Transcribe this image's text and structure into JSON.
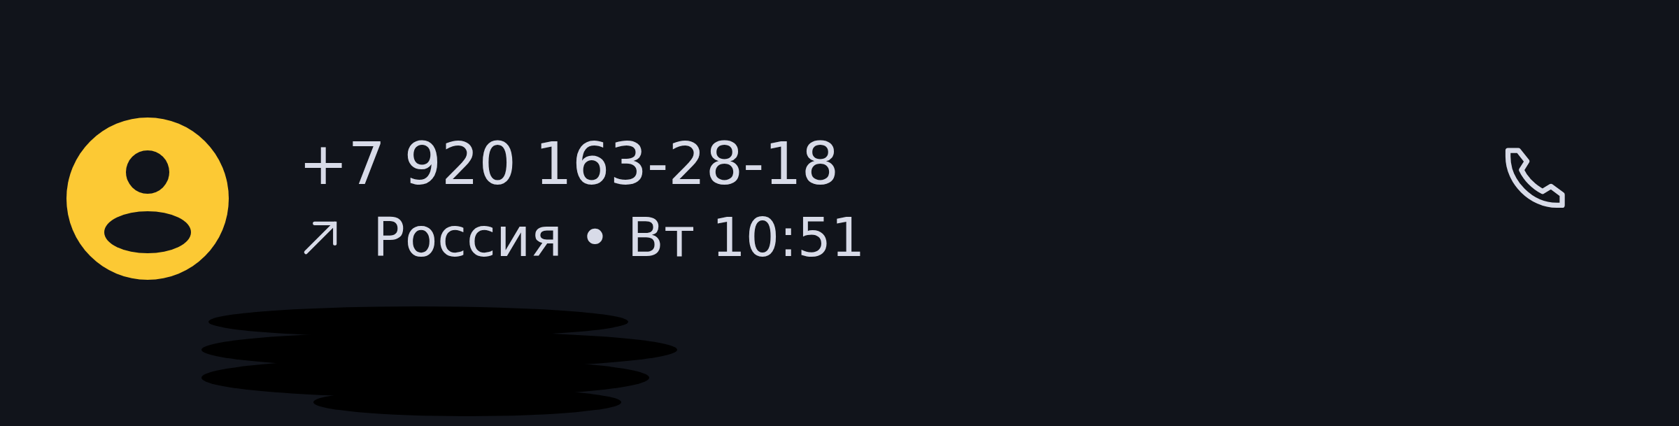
{
  "call_entry": {
    "number": "+7 920 163-28-18",
    "outgoing": true,
    "location": "Россия",
    "separator": "•",
    "time": "Вт 10:51"
  }
}
